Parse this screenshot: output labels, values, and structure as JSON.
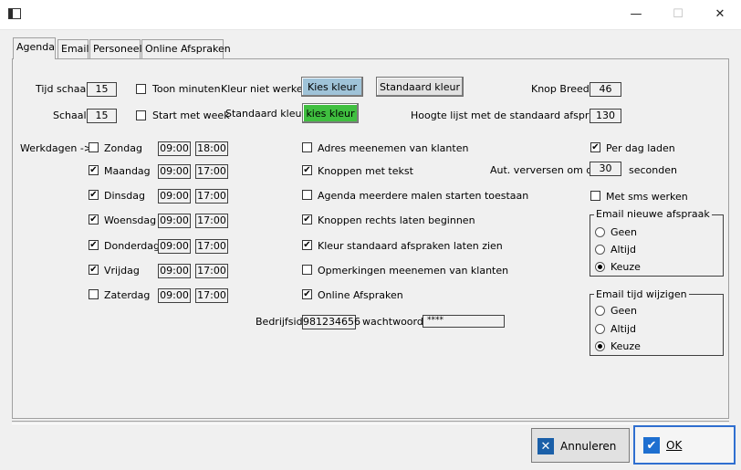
{
  "window": {
    "minimize": "—",
    "maximize": "☐",
    "close": "✕"
  },
  "tabs": [
    "Agenda",
    "Email",
    "Personeel",
    "Online Afspraken"
  ],
  "top": {
    "tijd_schaal_label": "Tijd schaal",
    "tijd_schaal_value": "15",
    "toon_minuten_label": "Toon minuten",
    "kleur_niet_werken_label": "Kleur niet werken",
    "kies_kleur1": "Kies kleur",
    "standaard_kleur_btn": "Standaard kleur",
    "knop_breed_label": "Knop Breed",
    "knop_breed_value": "46",
    "schaal_label": "Schaal",
    "schaal_value": "15",
    "start_met_week_label": "Start met week",
    "standaard_kleur_label": "Standaard kleur",
    "kies_kleur2": "kies kleur",
    "hoogte_label": "Hoogte lijst met de standaard afspraken",
    "hoogte_value": "130",
    "colors": {
      "kies_kleur1": "#9fc3d8",
      "kies_kleur2": "#3fbf3f"
    }
  },
  "werkdagen": {
    "label": "Werkdagen ->",
    "days": [
      {
        "name": "Zondag",
        "checked": false,
        "from": "09:00",
        "to": "18:00"
      },
      {
        "name": "Maandag",
        "checked": true,
        "from": "09:00",
        "to": "17:00"
      },
      {
        "name": "Dinsdag",
        "checked": true,
        "from": "09:00",
        "to": "17:00"
      },
      {
        "name": "Woensdag",
        "checked": true,
        "from": "09:00",
        "to": "17:00"
      },
      {
        "name": "Donderdag",
        "checked": true,
        "from": "09:00",
        "to": "17:00"
      },
      {
        "name": "Vrijdag",
        "checked": true,
        "from": "09:00",
        "to": "17:00"
      },
      {
        "name": "Zaterdag",
        "checked": false,
        "from": "09:00",
        "to": "17:00"
      }
    ]
  },
  "options": [
    {
      "label": "Adres meenemen van klanten",
      "checked": false
    },
    {
      "label": "Knoppen met tekst",
      "checked": true
    },
    {
      "label": "Agenda meerdere malen starten toestaan",
      "checked": false
    },
    {
      "label": "Knoppen rechts laten beginnen",
      "checked": true
    },
    {
      "label": "Kleur standaard afspraken laten zien",
      "checked": true
    },
    {
      "label": "Opmerkingen meenemen van klanten",
      "checked": false
    },
    {
      "label": "Online Afspraken",
      "checked": true
    }
  ],
  "bedrijf": {
    "label": "Bedrijfsid",
    "value": "981234656",
    "pw_label": "wachtwoord",
    "pw_value": "****"
  },
  "right": {
    "per_dag_laden": "Per dag laden",
    "per_dag_checked": true,
    "aut_label": "Aut. verversen om de",
    "aut_value": "30",
    "seconden": "seconden",
    "met_sms": "Met sms werken",
    "met_sms_checked": false
  },
  "group1": {
    "title": "Email nieuwe afspraak",
    "options": [
      "Geen",
      "Altijd",
      "Keuze"
    ],
    "selected": 2
  },
  "group2": {
    "title": "Email tijd wijzigen",
    "options": [
      "Geen",
      "Altijd",
      "Keuze"
    ],
    "selected": 2
  },
  "buttons": {
    "cancel": "Annuleren",
    "ok": "OK"
  }
}
